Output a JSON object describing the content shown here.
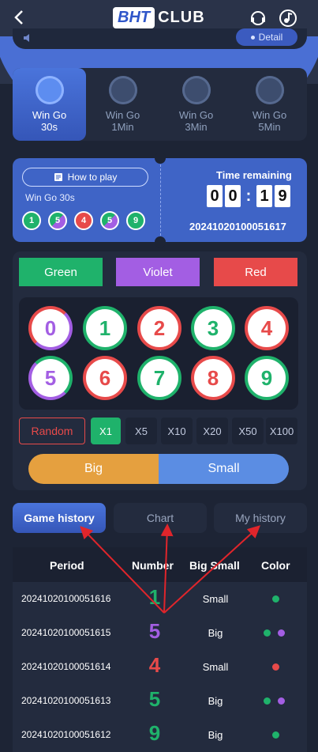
{
  "header": {
    "logo_prefix": "BHT",
    "logo_suffix": "CLUB"
  },
  "notice": {
    "detail_label": "Detail"
  },
  "game_tabs": [
    {
      "label1": "Win Go",
      "label2": "30s",
      "active": true
    },
    {
      "label1": "Win Go",
      "label2": "1Min",
      "active": false
    },
    {
      "label1": "Win Go",
      "label2": "3Min",
      "active": false
    },
    {
      "label1": "Win Go",
      "label2": "5Min",
      "active": false
    }
  ],
  "timer": {
    "how_to_play": "How to play",
    "game_name": "Win Go 30s",
    "recent_results": [
      "1",
      "5",
      "4",
      "5",
      "9"
    ],
    "time_label": "Time remaining",
    "digits": [
      "0",
      "0",
      ":",
      "1",
      "9"
    ],
    "period": "20241020100051617"
  },
  "colors": {
    "green": "#1fb26b",
    "violet": "#a35ee3",
    "red": "#e74a4a",
    "big": "#e5a03f",
    "small": "#5b8de3",
    "accent": "#3f64c6"
  },
  "bet": {
    "green_label": "Green",
    "violet_label": "Violet",
    "red_label": "Red",
    "numbers": [
      "0",
      "1",
      "2",
      "3",
      "4",
      "5",
      "6",
      "7",
      "8",
      "9"
    ],
    "random_label": "Random",
    "multipliers": [
      "X1",
      "X5",
      "X10",
      "X20",
      "X50",
      "X100"
    ],
    "big_label": "Big",
    "small_label": "Small"
  },
  "history_tabs": [
    "Game history",
    "Chart",
    "My history"
  ],
  "table": {
    "headers": [
      "Period",
      "Number",
      "Big Small",
      "Color"
    ],
    "rows": [
      {
        "period": "20241020100051616",
        "number": "1",
        "bigsmall": "Small"
      },
      {
        "period": "20241020100051615",
        "number": "5",
        "bigsmall": "Big"
      },
      {
        "period": "20241020100051614",
        "number": "4",
        "bigsmall": "Small"
      },
      {
        "period": "20241020100051613",
        "number": "5",
        "bigsmall": "Big"
      },
      {
        "period": "20241020100051612",
        "number": "9",
        "bigsmall": "Big"
      }
    ]
  }
}
